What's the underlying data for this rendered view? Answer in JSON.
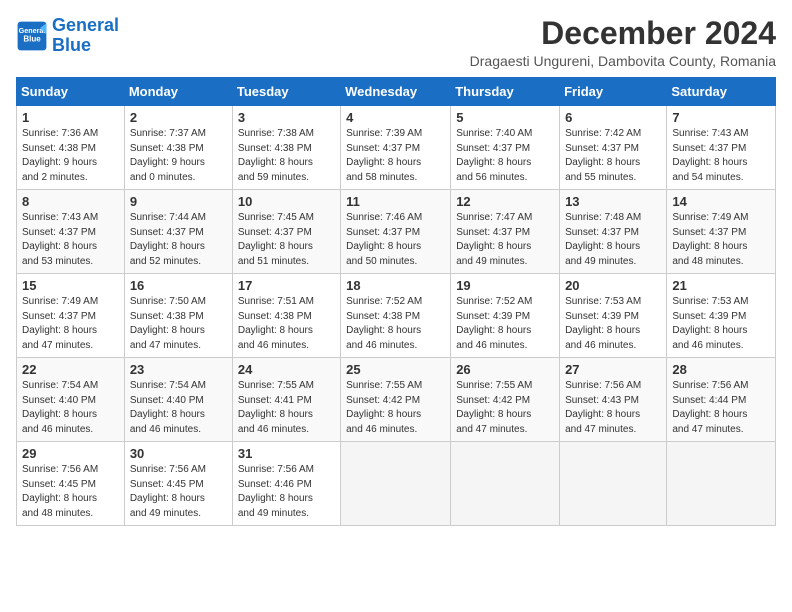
{
  "logo": {
    "line1": "General",
    "line2": "Blue"
  },
  "title": "December 2024",
  "subtitle": "Dragaesti Ungureni, Dambovita County, Romania",
  "days_header": [
    "Sunday",
    "Monday",
    "Tuesday",
    "Wednesday",
    "Thursday",
    "Friday",
    "Saturday"
  ],
  "weeks": [
    [
      {
        "day": "1",
        "detail": "Sunrise: 7:36 AM\nSunset: 4:38 PM\nDaylight: 9 hours\nand 2 minutes."
      },
      {
        "day": "2",
        "detail": "Sunrise: 7:37 AM\nSunset: 4:38 PM\nDaylight: 9 hours\nand 0 minutes."
      },
      {
        "day": "3",
        "detail": "Sunrise: 7:38 AM\nSunset: 4:38 PM\nDaylight: 8 hours\nand 59 minutes."
      },
      {
        "day": "4",
        "detail": "Sunrise: 7:39 AM\nSunset: 4:37 PM\nDaylight: 8 hours\nand 58 minutes."
      },
      {
        "day": "5",
        "detail": "Sunrise: 7:40 AM\nSunset: 4:37 PM\nDaylight: 8 hours\nand 56 minutes."
      },
      {
        "day": "6",
        "detail": "Sunrise: 7:42 AM\nSunset: 4:37 PM\nDaylight: 8 hours\nand 55 minutes."
      },
      {
        "day": "7",
        "detail": "Sunrise: 7:43 AM\nSunset: 4:37 PM\nDaylight: 8 hours\nand 54 minutes."
      }
    ],
    [
      {
        "day": "8",
        "detail": "Sunrise: 7:43 AM\nSunset: 4:37 PM\nDaylight: 8 hours\nand 53 minutes."
      },
      {
        "day": "9",
        "detail": "Sunrise: 7:44 AM\nSunset: 4:37 PM\nDaylight: 8 hours\nand 52 minutes."
      },
      {
        "day": "10",
        "detail": "Sunrise: 7:45 AM\nSunset: 4:37 PM\nDaylight: 8 hours\nand 51 minutes."
      },
      {
        "day": "11",
        "detail": "Sunrise: 7:46 AM\nSunset: 4:37 PM\nDaylight: 8 hours\nand 50 minutes."
      },
      {
        "day": "12",
        "detail": "Sunrise: 7:47 AM\nSunset: 4:37 PM\nDaylight: 8 hours\nand 49 minutes."
      },
      {
        "day": "13",
        "detail": "Sunrise: 7:48 AM\nSunset: 4:37 PM\nDaylight: 8 hours\nand 49 minutes."
      },
      {
        "day": "14",
        "detail": "Sunrise: 7:49 AM\nSunset: 4:37 PM\nDaylight: 8 hours\nand 48 minutes."
      }
    ],
    [
      {
        "day": "15",
        "detail": "Sunrise: 7:49 AM\nSunset: 4:37 PM\nDaylight: 8 hours\nand 47 minutes."
      },
      {
        "day": "16",
        "detail": "Sunrise: 7:50 AM\nSunset: 4:38 PM\nDaylight: 8 hours\nand 47 minutes."
      },
      {
        "day": "17",
        "detail": "Sunrise: 7:51 AM\nSunset: 4:38 PM\nDaylight: 8 hours\nand 46 minutes."
      },
      {
        "day": "18",
        "detail": "Sunrise: 7:52 AM\nSunset: 4:38 PM\nDaylight: 8 hours\nand 46 minutes."
      },
      {
        "day": "19",
        "detail": "Sunrise: 7:52 AM\nSunset: 4:39 PM\nDaylight: 8 hours\nand 46 minutes."
      },
      {
        "day": "20",
        "detail": "Sunrise: 7:53 AM\nSunset: 4:39 PM\nDaylight: 8 hours\nand 46 minutes."
      },
      {
        "day": "21",
        "detail": "Sunrise: 7:53 AM\nSunset: 4:39 PM\nDaylight: 8 hours\nand 46 minutes."
      }
    ],
    [
      {
        "day": "22",
        "detail": "Sunrise: 7:54 AM\nSunset: 4:40 PM\nDaylight: 8 hours\nand 46 minutes."
      },
      {
        "day": "23",
        "detail": "Sunrise: 7:54 AM\nSunset: 4:40 PM\nDaylight: 8 hours\nand 46 minutes."
      },
      {
        "day": "24",
        "detail": "Sunrise: 7:55 AM\nSunset: 4:41 PM\nDaylight: 8 hours\nand 46 minutes."
      },
      {
        "day": "25",
        "detail": "Sunrise: 7:55 AM\nSunset: 4:42 PM\nDaylight: 8 hours\nand 46 minutes."
      },
      {
        "day": "26",
        "detail": "Sunrise: 7:55 AM\nSunset: 4:42 PM\nDaylight: 8 hours\nand 47 minutes."
      },
      {
        "day": "27",
        "detail": "Sunrise: 7:56 AM\nSunset: 4:43 PM\nDaylight: 8 hours\nand 47 minutes."
      },
      {
        "day": "28",
        "detail": "Sunrise: 7:56 AM\nSunset: 4:44 PM\nDaylight: 8 hours\nand 47 minutes."
      }
    ],
    [
      {
        "day": "29",
        "detail": "Sunrise: 7:56 AM\nSunset: 4:45 PM\nDaylight: 8 hours\nand 48 minutes."
      },
      {
        "day": "30",
        "detail": "Sunrise: 7:56 AM\nSunset: 4:45 PM\nDaylight: 8 hours\nand 49 minutes."
      },
      {
        "day": "31",
        "detail": "Sunrise: 7:56 AM\nSunset: 4:46 PM\nDaylight: 8 hours\nand 49 minutes."
      },
      {
        "day": "",
        "detail": ""
      },
      {
        "day": "",
        "detail": ""
      },
      {
        "day": "",
        "detail": ""
      },
      {
        "day": "",
        "detail": ""
      }
    ]
  ]
}
